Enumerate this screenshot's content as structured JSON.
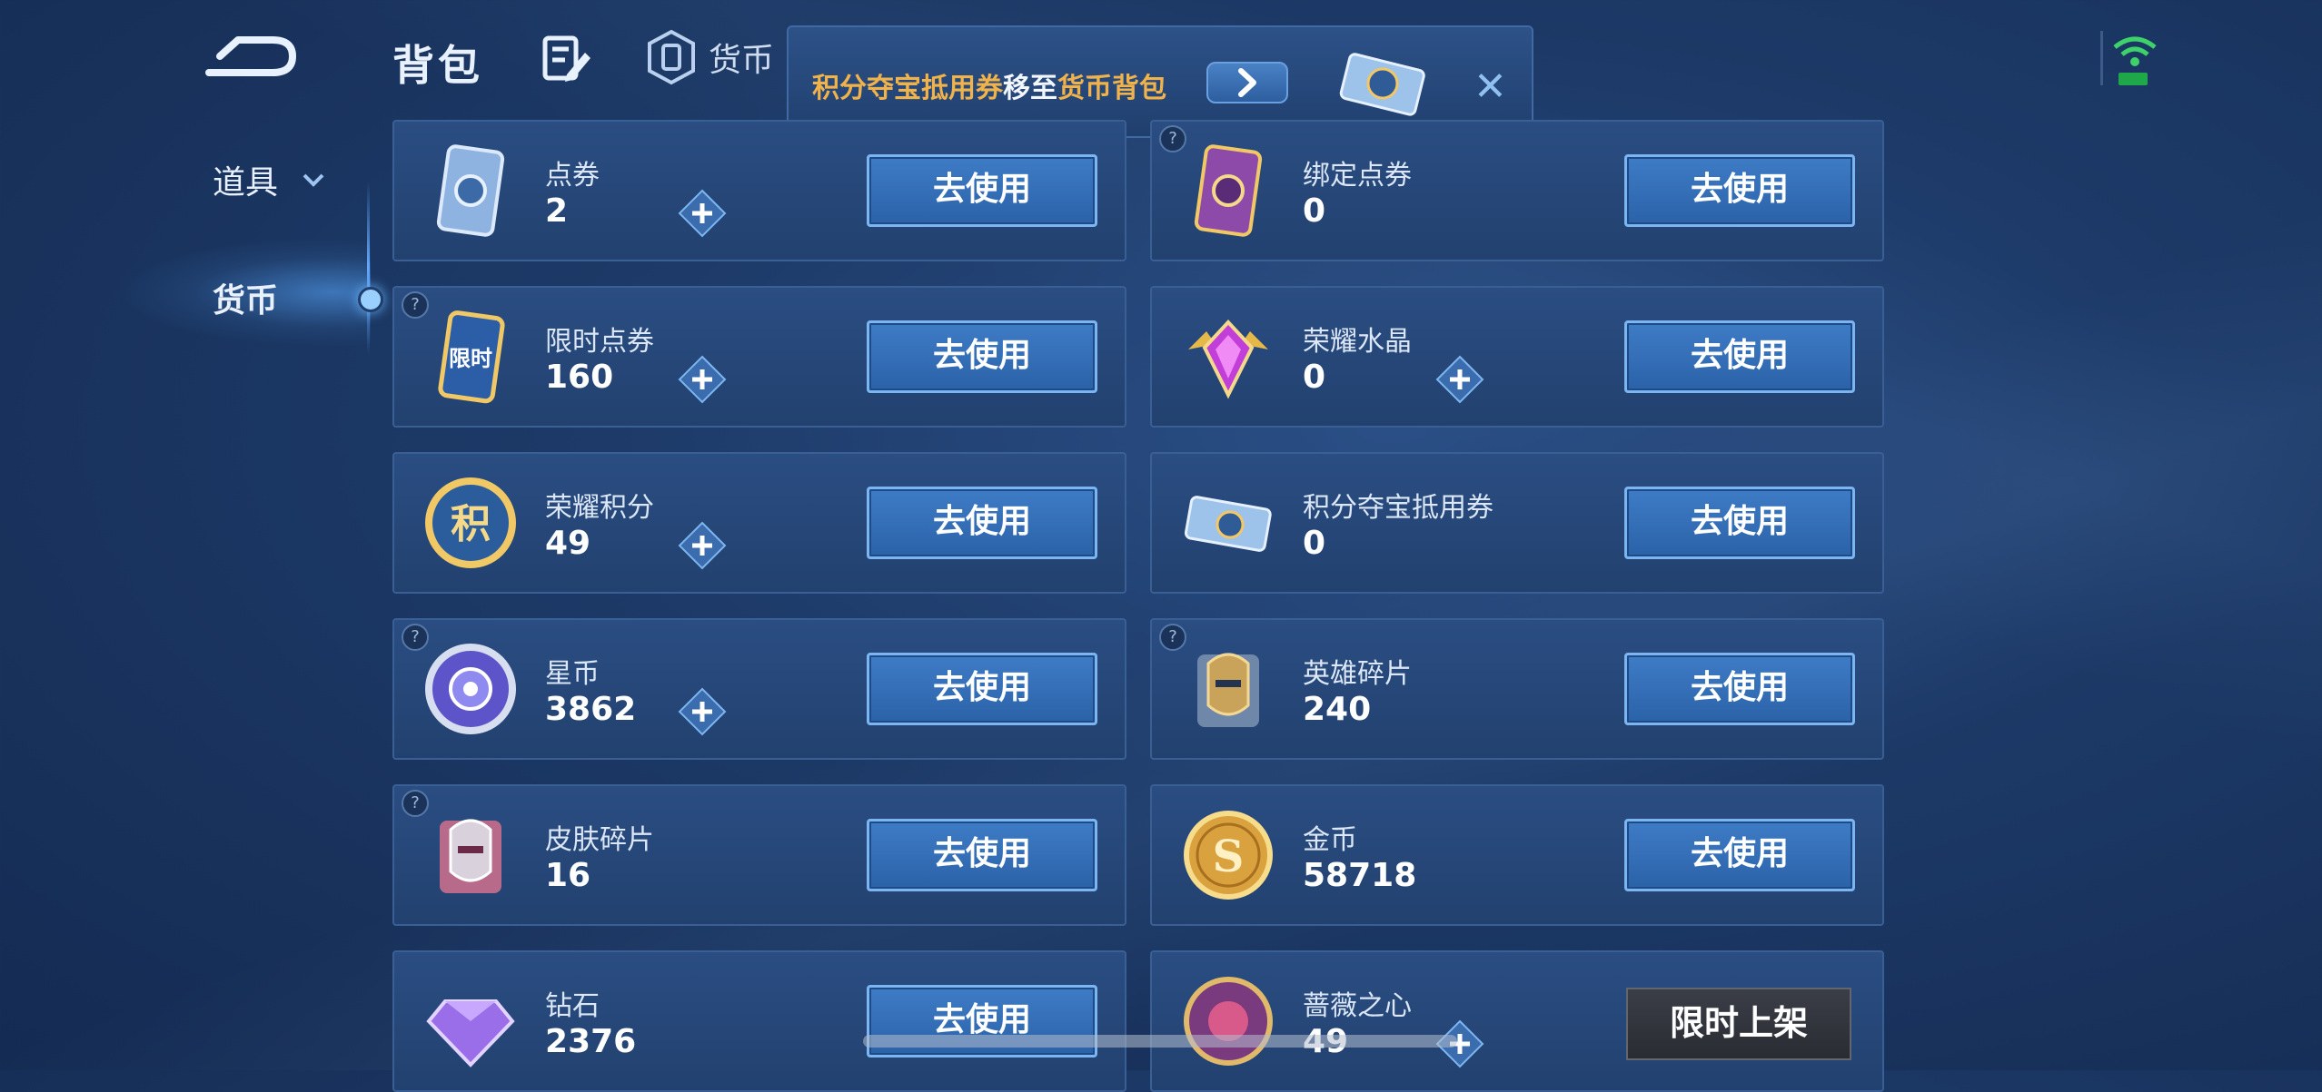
{
  "header": {
    "title": "背包",
    "currency_tab_label": "货币"
  },
  "notice": {
    "part1": "积分夺宝抵用券",
    "part2": "移至",
    "part3": "货币背包"
  },
  "sidebar": {
    "items": [
      {
        "label": "道具"
      },
      {
        "label": "货币"
      }
    ]
  },
  "use_label": "去使用",
  "cards": [
    {
      "name": "点券",
      "value": "2"
    },
    {
      "name": "绑定点券",
      "value": "0"
    },
    {
      "name": "限时点券",
      "value": "160"
    },
    {
      "name": "荣耀水晶",
      "value": "0"
    },
    {
      "name": "荣耀积分",
      "value": "49"
    },
    {
      "name": "积分夺宝抵用券",
      "value": "0"
    },
    {
      "name": "星币",
      "value": "3862"
    },
    {
      "name": "英雄碎片",
      "value": "240"
    },
    {
      "name": "皮肤碎片",
      "value": "16"
    },
    {
      "name": "金币",
      "value": "58718"
    },
    {
      "name": "钻石",
      "value": "2376"
    },
    {
      "name": "蔷薇之心",
      "value": "49"
    }
  ],
  "icon_texts": {
    "limited_coupon": "限时",
    "honor_points": "积",
    "gold": "S"
  },
  "limited_sale": "限时上架",
  "colors": {
    "accent": "#3e7cc6",
    "notice_orange": "#f0b24a"
  }
}
